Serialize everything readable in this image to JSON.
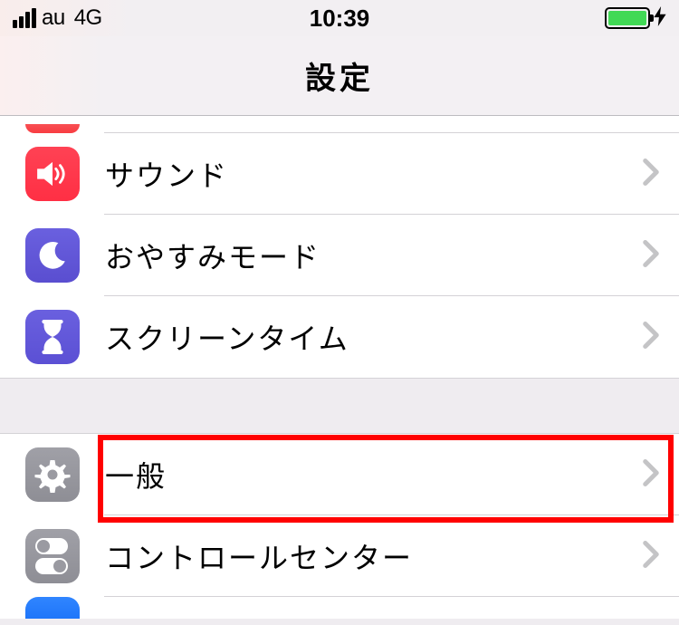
{
  "status": {
    "carrier": "au",
    "network": "4G",
    "time": "10:39"
  },
  "nav": {
    "title": "設定"
  },
  "rows": {
    "sound": {
      "label": "サウンド"
    },
    "dnd": {
      "label": "おやすみモード"
    },
    "screentime": {
      "label": "スクリーンタイム"
    },
    "general": {
      "label": "一般"
    },
    "control": {
      "label": "コントロールセンター"
    }
  }
}
